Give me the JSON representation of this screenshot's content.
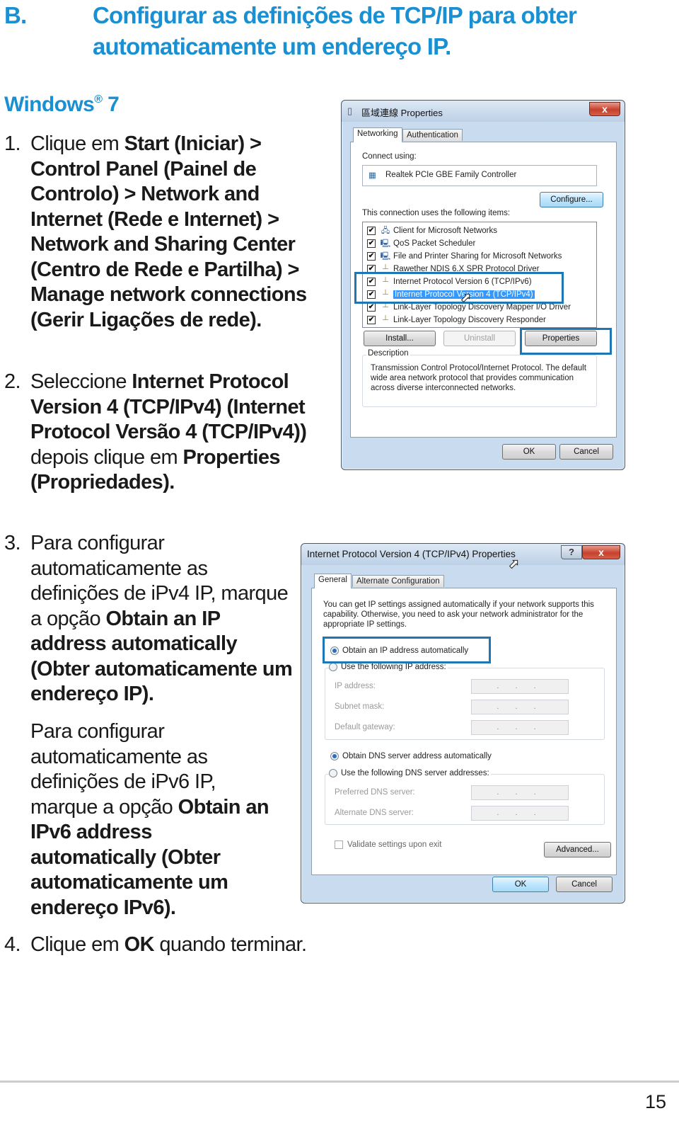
{
  "heading": {
    "letter": "B.",
    "title": "Configurar as definições de TCP/IP para obter automaticamente um endereço IP."
  },
  "subheading": {
    "name": "Windows",
    "reg": "®",
    "version": "7"
  },
  "steps": [
    {
      "number": "1.",
      "parts": [
        {
          "text": "Clique em ",
          "bold": false
        },
        {
          "text": "Start (Iniciar) > Control Panel (Painel de Controlo) > Network and Internet (Rede e Internet) > Network and Sharing Center (Centro de Rede e Partilha) > Manage network connections (Gerir Ligações de rede).",
          "bold": true
        }
      ]
    },
    {
      "number": "2.",
      "parts": [
        {
          "text": "Seleccione ",
          "bold": false
        },
        {
          "text": "Internet Protocol Version 4 (TCP/IPv4) (Internet Protocol Versão 4 (TCP/IPv4))",
          "bold": true
        },
        {
          "text": " depois clique em ",
          "bold": false
        },
        {
          "text": "Properties (Propriedades).",
          "bold": true
        }
      ]
    },
    {
      "number": "3.",
      "parts": [
        {
          "text": "Para configurar automaticamente as definições de iPv4 IP, marque a opção ",
          "bold": false
        },
        {
          "text": "Obtain an IP address automatically (Obter automaticamente um endereço IP).",
          "bold": true
        }
      ]
    },
    {
      "number": "",
      "parts": [
        {
          "text": "Para configurar automaticamente as definições de iPv6 IP, marque a opção ",
          "bold": false
        },
        {
          "text": "Obtain an IPv6 address automatically (Obter automaticamente um endereço IPv6).",
          "bold": true
        }
      ]
    },
    {
      "number": "4.",
      "parts": [
        {
          "text": "Clique em ",
          "bold": false
        },
        {
          "text": "OK",
          "bold": true
        },
        {
          "text": " quando terminar.",
          "bold": false
        }
      ]
    }
  ],
  "dialog1": {
    "title": "區域連線 Properties",
    "close_label": "x",
    "tabs": [
      "Networking",
      "Authentication"
    ],
    "connect_using_label": "Connect using:",
    "adapter": "Realtek PCIe GBE Family Controller",
    "configure_button": "Configure...",
    "items_label": "This connection uses the following items:",
    "items": [
      {
        "label": "Client for Microsoft Networks",
        "checked": true,
        "icon": "network-client-icon",
        "selected": false
      },
      {
        "label": "QoS Packet Scheduler",
        "checked": true,
        "icon": "computer-icon",
        "selected": false
      },
      {
        "label": "File and Printer Sharing for Microsoft Networks",
        "checked": true,
        "icon": "computer-icon",
        "selected": false
      },
      {
        "label": "Rawether NDIS 6.X SPR Protocol Driver",
        "checked": true,
        "icon": "protocol-icon",
        "selected": false
      },
      {
        "label": "Internet Protocol Version 6 (TCP/IPv6)",
        "checked": true,
        "icon": "protocol-icon",
        "selected": false
      },
      {
        "label": "Internet Protocol Version 4 (TCP/IPv4)",
        "checked": true,
        "icon": "protocol-icon",
        "selected": true
      },
      {
        "label": "Link-Layer Topology Discovery Mapper I/O Driver",
        "checked": true,
        "icon": "protocol-icon",
        "selected": false
      },
      {
        "label": "Link-Layer Topology Discovery Responder",
        "checked": true,
        "icon": "protocol-icon",
        "selected": false
      }
    ],
    "install_button": "Install...",
    "uninstall_button": "Uninstall",
    "properties_button": "Properties",
    "description_label": "Description",
    "description_text": "Transmission Control Protocol/Internet Protocol. The default wide area network protocol that provides communication across diverse interconnected networks.",
    "ok_button": "OK",
    "cancel_button": "Cancel"
  },
  "dialog2": {
    "title": "Internet Protocol Version 4 (TCP/IPv4) Properties",
    "help_label": "?",
    "close_label": "x",
    "tabs": [
      "General",
      "Alternate Configuration"
    ],
    "intro": "You can get IP settings assigned automatically if your network supports this capability. Otherwise, you need to ask your network administrator for the appropriate IP settings.",
    "ip_auto_label": "Obtain an IP address automatically",
    "ip_auto_selected": true,
    "ip_manual_label": "Use the following IP address:",
    "ip_fields": [
      {
        "label": "IP address:",
        "value": ". . ."
      },
      {
        "label": "Subnet mask:",
        "value": ". . ."
      },
      {
        "label": "Default gateway:",
        "value": ". . ."
      }
    ],
    "dns_auto_label": "Obtain DNS server address automatically",
    "dns_auto_selected": true,
    "dns_manual_label": "Use the following DNS server addresses:",
    "dns_fields": [
      {
        "label": "Preferred DNS server:",
        "value": ". . ."
      },
      {
        "label": "Alternate DNS server:",
        "value": ". . ."
      }
    ],
    "validate_label": "Validate settings upon exit",
    "validate_checked": false,
    "advanced_button": "Advanced...",
    "ok_button": "OK",
    "cancel_button": "Cancel"
  },
  "footer": {
    "page_number": "15"
  }
}
